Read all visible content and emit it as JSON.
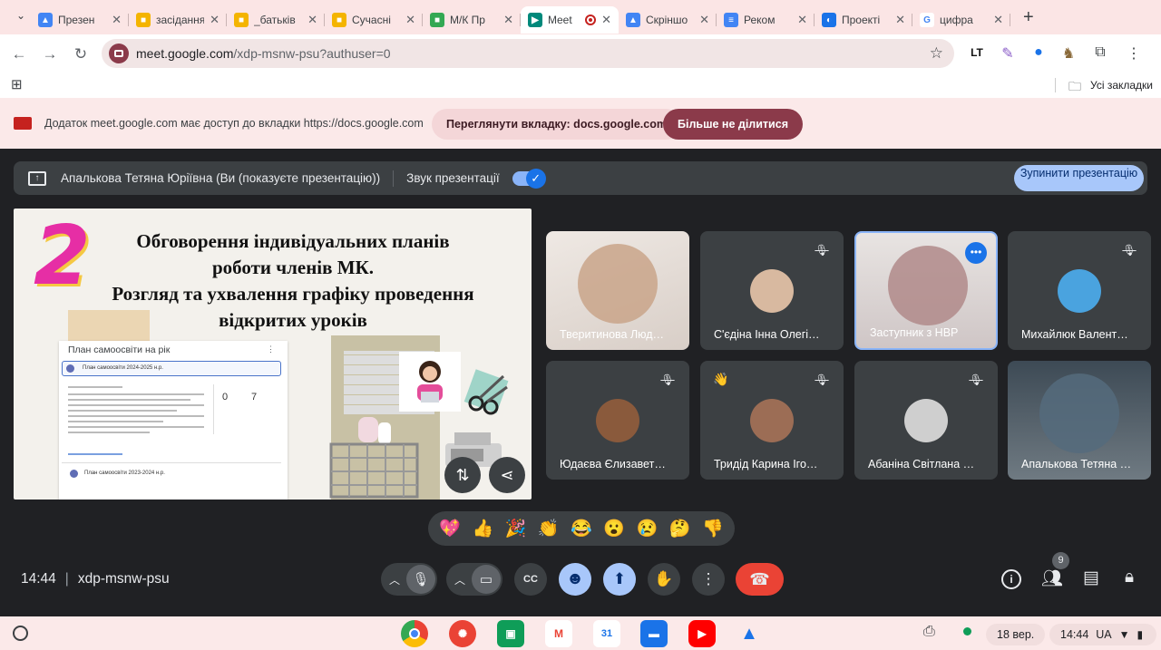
{
  "browser": {
    "tabs": [
      {
        "label": "Презен",
        "color": "#4285f4",
        "glyph": "▲",
        "active": false
      },
      {
        "label": "засідання",
        "color": "#f4b400",
        "glyph": "■",
        "active": false
      },
      {
        "label": "_батьків",
        "color": "#f4b400",
        "glyph": "■",
        "active": false
      },
      {
        "label": "Сучасні",
        "color": "#f4b400",
        "glyph": "■",
        "active": false
      },
      {
        "label": "М/К Пр",
        "color": "#34a853",
        "glyph": "■",
        "active": false
      },
      {
        "label": "Meet",
        "color": "#00897b",
        "glyph": "▶",
        "active": true
      },
      {
        "label": "Скріншо",
        "color": "#4285f4",
        "glyph": "▲",
        "active": false
      },
      {
        "label": "Реком",
        "color": "#4285f4",
        "glyph": "≡",
        "active": false
      },
      {
        "label": "Проекті",
        "color": "#1a73e8",
        "glyph": "◐",
        "active": false
      },
      {
        "label": "цифра",
        "color": "#ffffff",
        "glyph": "G",
        "active": false
      }
    ],
    "url_host": "meet.google.com",
    "url_path": "/xdp-msnw-psu?authuser=0",
    "all_bookmarks": "Усі закладки"
  },
  "share_banner": {
    "text": "Додаток meet.google.com має доступ до вкладки https://docs.google.com",
    "view_tab": "Переглянути вкладку: docs.google.com",
    "stop_sharing": "Більше не ділитися"
  },
  "presenting_bar": {
    "presenter": "Апалькова Тетяна Юріївна (Ви (показуєте презентацію))",
    "audio_label": "Звук презентації",
    "stop_label": "Зупинити презентацію"
  },
  "slide": {
    "number": "2",
    "title_lines": [
      "Обговорення індивідуальних планів",
      "роботи членів МК.",
      "Розгляд та ухвалення графіку проведення",
      "відкритих уроків"
    ],
    "panel_title": "План самоосвіти на рік",
    "panel_item1": "План самоосвіти 2024-2025 н.р.",
    "panel_item2": "План самоосвіти 2023-2024 н.р.",
    "stat1": "0",
    "stat2": "7"
  },
  "participants": [
    {
      "name": "Тверитинова Люд…",
      "muted": false,
      "avatar_color": "#c9a58a"
    },
    {
      "name": "С'єдіна Інна Олегі…",
      "muted": true,
      "avatar_color": "#d8b9a0"
    },
    {
      "name": "Заступник з НВР",
      "muted": false,
      "avatar_color": "#b08a8a"
    },
    {
      "name": "Михайлюк Валент…",
      "muted": true,
      "avatar_color": "#4aa3df"
    },
    {
      "name": "Юдаєва Єлизавет…",
      "muted": true,
      "avatar_color": "#8a5a3c"
    },
    {
      "name": "Тридід Карина Іго…",
      "muted": true,
      "avatar_color": "#9c6d55"
    },
    {
      "name": "Абаніна Світлана …",
      "muted": true,
      "avatar_color": "#cfcfcf"
    },
    {
      "name": "Апалькова Тетяна …",
      "muted": false,
      "avatar_color": "#556b7d"
    }
  ],
  "reactions": [
    "💖",
    "👍",
    "🎉",
    "👏",
    "😂",
    "😮",
    "😢",
    "🤔",
    "👎"
  ],
  "meeting": {
    "time": "14:44",
    "code": "xdp-msnw-psu",
    "people_count": "9"
  },
  "tray": {
    "date": "18 вер.",
    "time": "14:44",
    "lang": "UA"
  },
  "colors": {
    "accent": "#a8c7fa",
    "end_call": "#ea4335",
    "stop_share_button": "#8b3a4a"
  }
}
